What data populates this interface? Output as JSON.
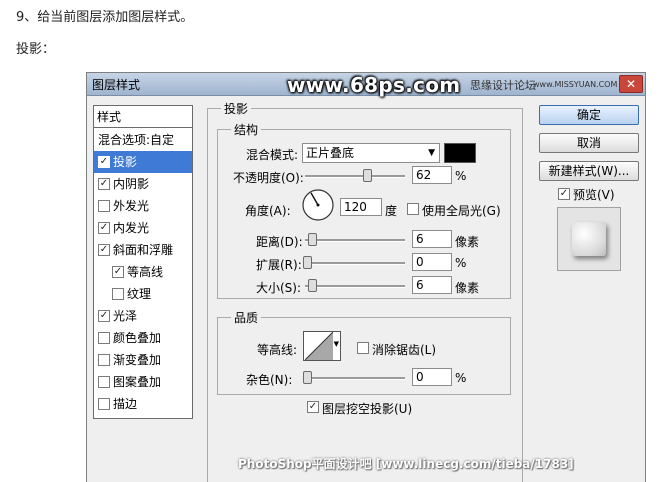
{
  "article": {
    "step": "9、给当前图层添加图层样式。",
    "section": "投影："
  },
  "dialog": {
    "title": "图层样式",
    "watermark": "www.68ps.com",
    "forum": "思缘设计论坛",
    "forum_url": "www.MISSYUAN.COM",
    "close": "✕"
  },
  "styles_panel": {
    "header": "样式",
    "items": [
      {
        "label": "混合选项:自定",
        "checkbox": false,
        "checked": false,
        "indent": 0,
        "selected": false
      },
      {
        "label": "投影",
        "checkbox": true,
        "checked": true,
        "indent": 0,
        "selected": true
      },
      {
        "label": "内阴影",
        "checkbox": true,
        "checked": true,
        "indent": 0,
        "selected": false
      },
      {
        "label": "外发光",
        "checkbox": true,
        "checked": false,
        "indent": 0,
        "selected": false
      },
      {
        "label": "内发光",
        "checkbox": true,
        "checked": true,
        "indent": 0,
        "selected": false
      },
      {
        "label": "斜面和浮雕",
        "checkbox": true,
        "checked": true,
        "indent": 0,
        "selected": false
      },
      {
        "label": "等高线",
        "checkbox": true,
        "checked": true,
        "indent": 1,
        "selected": false
      },
      {
        "label": "纹理",
        "checkbox": true,
        "checked": false,
        "indent": 1,
        "selected": false
      },
      {
        "label": "光泽",
        "checkbox": true,
        "checked": true,
        "indent": 0,
        "selected": false
      },
      {
        "label": "颜色叠加",
        "checkbox": true,
        "checked": false,
        "indent": 0,
        "selected": false
      },
      {
        "label": "渐变叠加",
        "checkbox": true,
        "checked": false,
        "indent": 0,
        "selected": false
      },
      {
        "label": "图案叠加",
        "checkbox": true,
        "checked": false,
        "indent": 0,
        "selected": false
      },
      {
        "label": "描边",
        "checkbox": true,
        "checked": false,
        "indent": 0,
        "selected": false
      }
    ]
  },
  "drop_shadow": {
    "title": "投影",
    "structure": {
      "title": "结构",
      "blend_mode_label": "混合模式:",
      "blend_mode_value": "正片叠底",
      "shadow_color": "#000000",
      "opacity_label": "不透明度(O):",
      "opacity_value": "62",
      "opacity_fraction": 0.62,
      "opacity_unit": "%",
      "angle_label": "角度(A):",
      "angle_value": "120",
      "angle_unit": "度",
      "global_light_label": "使用全局光(G)",
      "global_light_checked": false,
      "distance_label": "距离(D):",
      "distance_value": "6",
      "distance_unit": "像素",
      "spread_label": "扩展(R):",
      "spread_value": "0",
      "spread_unit": "%",
      "size_label": "大小(S):",
      "size_value": "6",
      "size_unit": "像素"
    },
    "quality": {
      "title": "品质",
      "contour_label": "等高线:",
      "anti_alias_label": "消除锯齿(L)",
      "anti_alias_checked": false,
      "noise_label": "杂色(N):",
      "noise_value": "0",
      "noise_unit": "%"
    },
    "knockout_label": "图层挖空投影(U)",
    "knockout_checked": true
  },
  "buttons": {
    "ok": "确定",
    "cancel": "取消",
    "new_style": "新建样式(W)...",
    "preview_label": "预览(V)",
    "preview_checked": true
  },
  "footer_watermark": "PhotoShop平面设计吧 [www.linecg.com/tieba/1783]",
  "colors": {
    "selection": "#3f7ad7",
    "titlebar": "#b3c4db",
    "dialog_bg": "#efefef"
  }
}
